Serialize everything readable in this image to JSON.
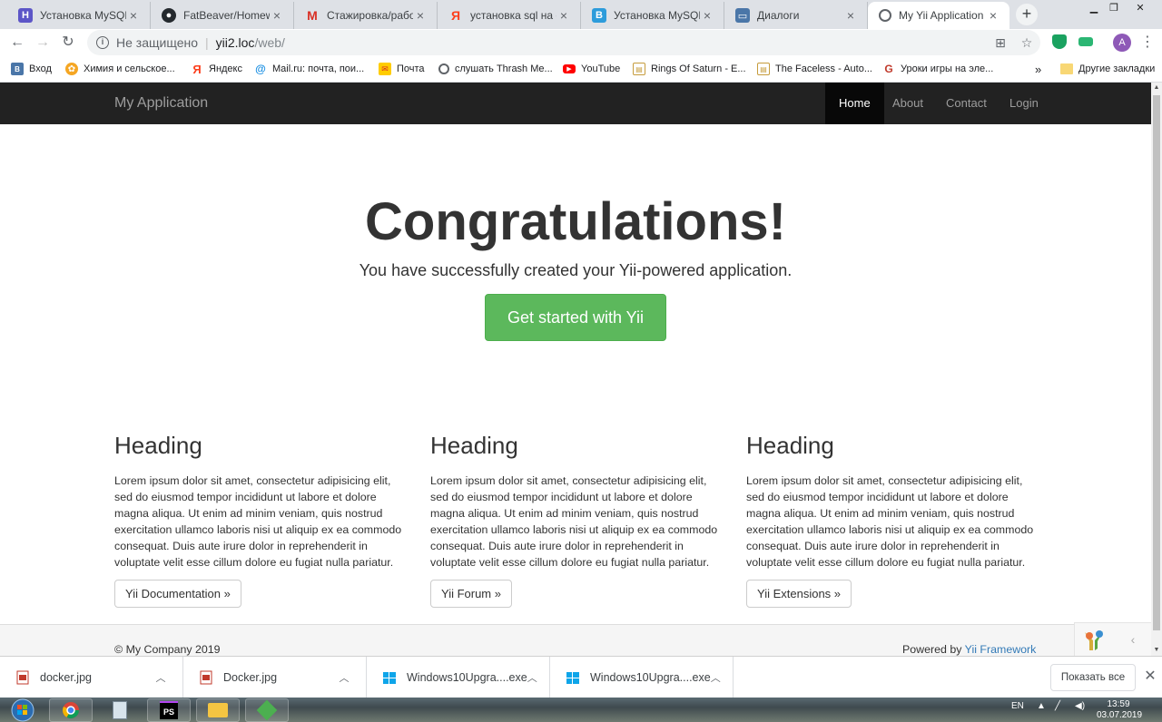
{
  "browser": {
    "tabs": [
      {
        "title": "Установка MySQL на",
        "favicon": "H",
        "favicon_color": "#5c55c7",
        "active": false
      },
      {
        "title": "FatBeaver/Homework",
        "favicon": "github-icon",
        "favicon_color": "#24292e",
        "active": false
      },
      {
        "title": "Стажировка/работа",
        "favicon": "M",
        "favicon_color": "#d93025",
        "active": false
      },
      {
        "title": "установка sql на cen",
        "favicon": "Я",
        "favicon_color": "#fc3f1d",
        "active": false
      },
      {
        "title": "Установка MySQL в",
        "favicon": "B",
        "favicon_color": "#2d9cdb",
        "active": false
      },
      {
        "title": "Диалоги",
        "favicon": "chat-icon",
        "favicon_color": "#4a76a8",
        "active": false
      },
      {
        "title": "My Yii Application",
        "favicon": "globe-icon",
        "favicon_color": "#5f6368",
        "active": true
      }
    ],
    "omnibox": {
      "security_label": "Не защищено",
      "host": "yii2.loc",
      "path": "/web/"
    },
    "profile_initial": "A",
    "bookmarks": [
      {
        "label": "Вход",
        "icon": "vk"
      },
      {
        "label": "Химия и сельское...",
        "icon": "chem"
      },
      {
        "label": "Яндекс",
        "icon": "yandex"
      },
      {
        "label": "Mail.ru: почта, пои...",
        "icon": "mailru"
      },
      {
        "label": "Почта",
        "icon": "mail"
      },
      {
        "label": "слушать Thrash Me...",
        "icon": "music"
      },
      {
        "label": "YouTube",
        "icon": "youtube"
      },
      {
        "label": "Rings Of Saturn - E...",
        "icon": "page"
      },
      {
        "label": "The Faceless - Auto...",
        "icon": "page"
      },
      {
        "label": "Уроки игры на эле...",
        "icon": "guitar"
      }
    ],
    "bookmarks_overflow": "»",
    "other_bookmarks": "Другие закладки"
  },
  "page": {
    "brand": "My Application",
    "nav": [
      {
        "label": "Home",
        "active": true
      },
      {
        "label": "About",
        "active": false
      },
      {
        "label": "Contact",
        "active": false
      },
      {
        "label": "Login",
        "active": false
      }
    ],
    "hero": {
      "title": "Congratulations!",
      "lead": "You have successfully created your Yii-powered application.",
      "button": "Get started with Yii"
    },
    "columns": [
      {
        "heading": "Heading",
        "text": "Lorem ipsum dolor sit amet, consectetur adipisicing elit, sed do eiusmod tempor incididunt ut labore et dolore magna aliqua. Ut enim ad minim veniam, quis nostrud exercitation ullamco laboris nisi ut aliquip ex ea commodo consequat. Duis aute irure dolor in reprehenderit in voluptate velit esse cillum dolore eu fugiat nulla pariatur.",
        "button": "Yii Documentation »"
      },
      {
        "heading": "Heading",
        "text": "Lorem ipsum dolor sit amet, consectetur adipisicing elit, sed do eiusmod tempor incididunt ut labore et dolore magna aliqua. Ut enim ad minim veniam, quis nostrud exercitation ullamco laboris nisi ut aliquip ex ea commodo consequat. Duis aute irure dolor in reprehenderit in voluptate velit esse cillum dolore eu fugiat nulla pariatur.",
        "button": "Yii Forum »"
      },
      {
        "heading": "Heading",
        "text": "Lorem ipsum dolor sit amet, consectetur adipisicing elit, sed do eiusmod tempor incididunt ut labore et dolore magna aliqua. Ut enim ad minim veniam, quis nostrud exercitation ullamco laboris nisi ut aliquip ex ea commodo consequat. Duis aute irure dolor in reprehenderit in voluptate velit esse cillum dolore eu fugiat nulla pariatur.",
        "button": "Yii Extensions »"
      }
    ],
    "footer": {
      "copyright": "© My Company 2019",
      "powered_prefix": "Powered by ",
      "powered_link": "Yii Framework"
    },
    "colors": {
      "navbar": "#222222",
      "success": "#5cb85c",
      "link": "#337ab7"
    }
  },
  "downloads": {
    "items": [
      {
        "name": "docker.jpg",
        "icon": "image-file-icon"
      },
      {
        "name": "Docker.jpg",
        "icon": "image-file-icon"
      },
      {
        "name": "Windows10Upgra....exe",
        "icon": "windows-icon"
      },
      {
        "name": "Windows10Upgra....exe",
        "icon": "windows-icon"
      }
    ],
    "show_all": "Показать все"
  },
  "taskbar": {
    "language": "EN",
    "time": "13:59",
    "date": "03.07.2019"
  }
}
